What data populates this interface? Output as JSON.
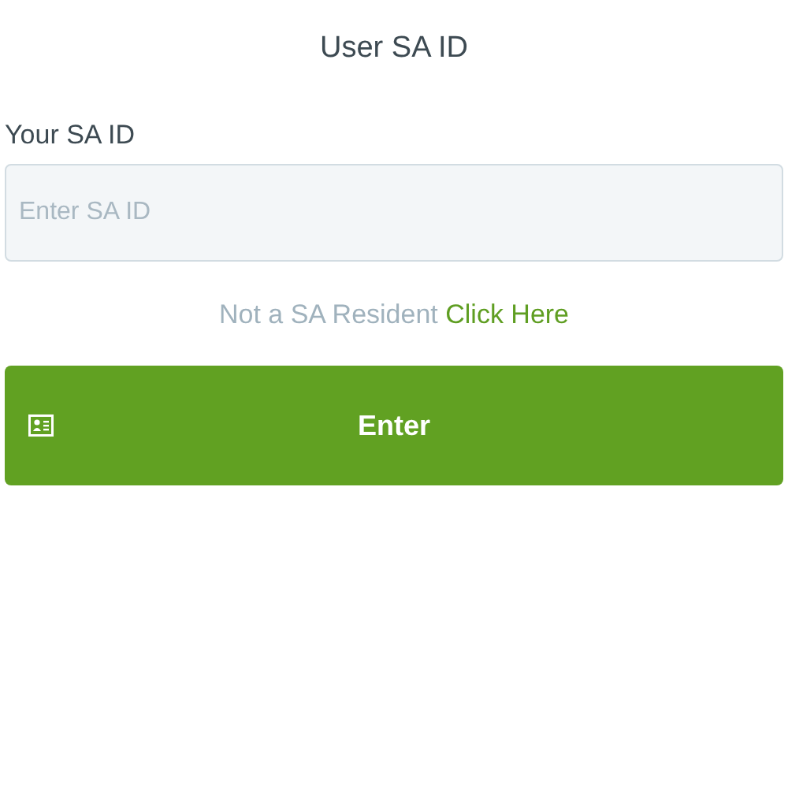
{
  "title": "User SA ID",
  "field": {
    "label": "Your SA ID",
    "placeholder": "Enter SA ID"
  },
  "resident_note": {
    "text": "Not a SA Resident",
    "link": "Click Here"
  },
  "submit_button": {
    "label": "Enter"
  }
}
